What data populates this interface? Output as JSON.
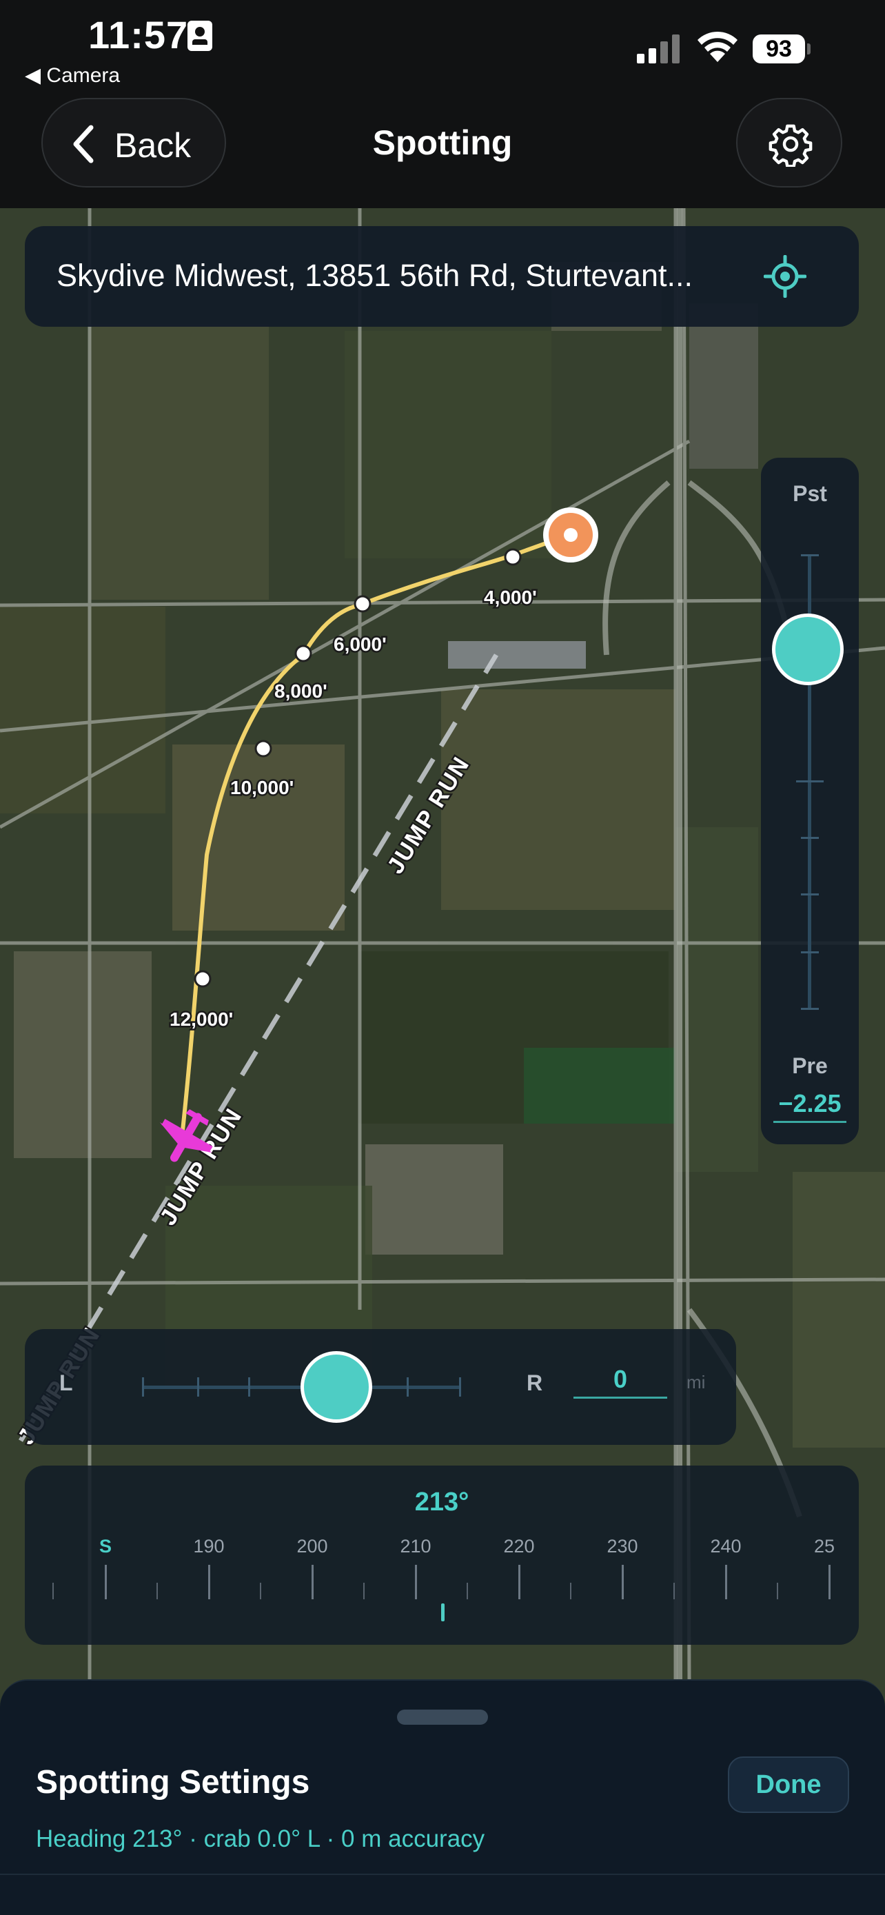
{
  "status_bar": {
    "time": "11:57",
    "back_to_app": "Camera",
    "battery": "93"
  },
  "nav": {
    "back_label": "Back",
    "title": "Spotting"
  },
  "location": {
    "address": "Skydive Midwest, 13851 56th Rd, Sturtevant..."
  },
  "map": {
    "altitudes": [
      "4,000'",
      "6,000'",
      "8,000'",
      "10,000'",
      "12,000'"
    ],
    "jump_run_label": "JUMP RUN",
    "colors": {
      "path": "#f1d36b",
      "target": "#f2945a",
      "aircraft": "#e83ad8",
      "jump_run": "#c9ced3"
    }
  },
  "spot_slider": {
    "top_label": "Pst",
    "bottom_label": "Pre",
    "value": "−2.25"
  },
  "offset_slider": {
    "left_label": "L",
    "right_label": "R",
    "value": "0",
    "unit": "mi"
  },
  "compass": {
    "heading": "213°",
    "ticks": [
      "S",
      "190",
      "200",
      "210",
      "220",
      "230",
      "240",
      "25"
    ]
  },
  "sheet": {
    "title": "Spotting Settings",
    "done_label": "Done",
    "subtitle": "Heading 213°  ·  crab 0.0° L  ·  0 m accuracy"
  },
  "accent_color": "#4ecdc4"
}
